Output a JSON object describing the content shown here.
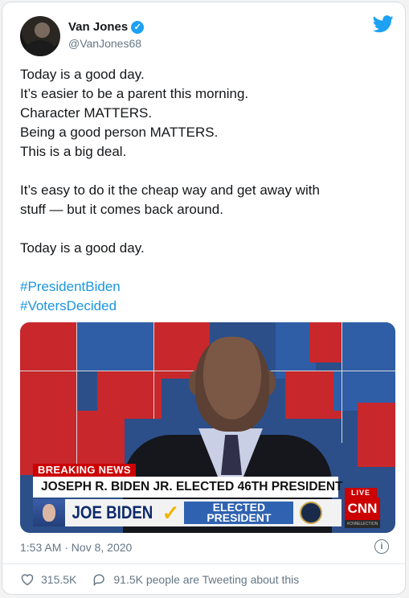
{
  "author": {
    "name": "Van Jones",
    "handle": "@VanJones68"
  },
  "tweet": {
    "lines_block1": [
      "Today is a good day.",
      "It’s easier to be a parent this morning.",
      "Character MATTERS.",
      "Being a good person MATTERS.",
      "This is a big deal."
    ],
    "lines_block2": [
      "It’s easy to do it the cheap way and get away with",
      "stuff — but it comes back around."
    ],
    "line_block3": "Today is a good day.",
    "hashtags": [
      "#PresidentBiden",
      "#VotersDecided"
    ]
  },
  "media": {
    "breaking_label": "BREAKING NEWS",
    "headline": "JOSEPH R. BIDEN JR. ELECTED 46TH PRESIDENT",
    "lower_third_name": "JOE BIDEN",
    "elected_line1": "ELECTED",
    "elected_line2": "PRESIDENT",
    "live_label": "LIVE",
    "network": "CNN",
    "network_sub": "#CNNELECTION"
  },
  "meta": {
    "timestamp": "1:53 AM · Nov 8, 2020",
    "likes": "315.5K",
    "conversation": "91.5K people are Tweeting about this"
  },
  "colors": {
    "link_blue": "#1b95e0",
    "twitter_blue": "#1da1f2",
    "cnn_red": "#cc0000"
  },
  "icons": [
    "verified-icon",
    "twitter-bird-icon",
    "info-icon",
    "heart-icon",
    "reply-bubble-icon"
  ]
}
